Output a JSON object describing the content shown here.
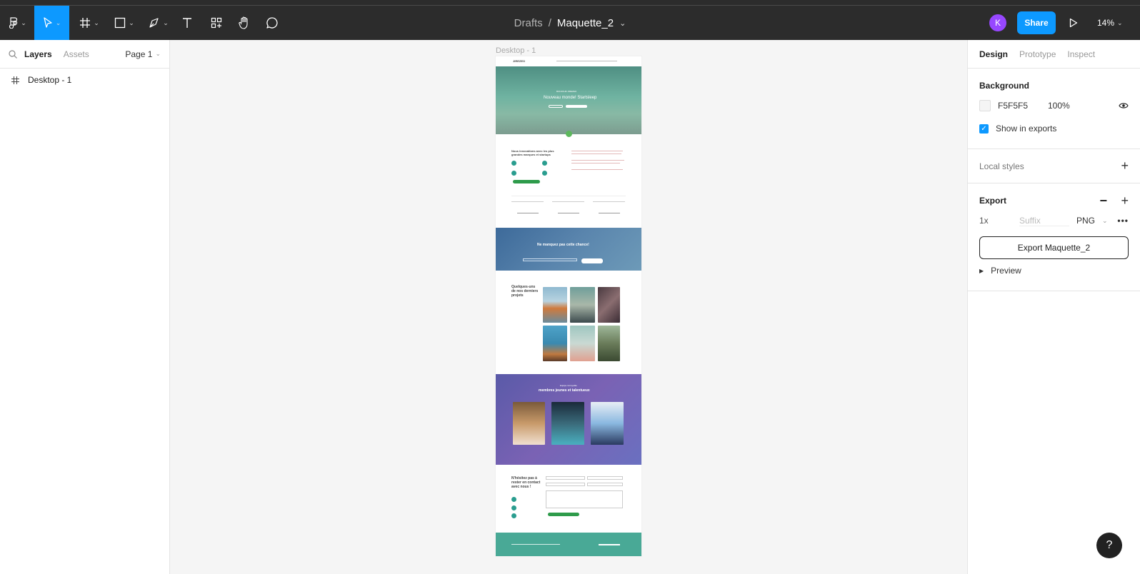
{
  "toolbar": {
    "breadcrumb_parent": "Drafts",
    "breadcrumb_sep": "/",
    "file_name": "Maquette_2",
    "avatar_letter": "K",
    "share_label": "Share",
    "zoom": "14%"
  },
  "left_panel": {
    "tab_layers": "Layers",
    "tab_assets": "Assets",
    "page": "Page 1",
    "layers": [
      {
        "name": "Desktop - 1"
      }
    ]
  },
  "canvas": {
    "frame_label": "Desktop - 1",
    "design": {
      "logo": "JIREZEO",
      "hero_kicker": "BONJOUR JIREZEO",
      "hero_title": "Nouveau monde! Startsleep",
      "newsletter_title": "Ne manquez pas cette chance!",
      "projects_title": "Quelques-uns de nos derniers projets",
      "team_kicker": "Equipe incroyable",
      "team_title": "membres jeunes et talentueux",
      "contact_title": "N'hésitez pas à rester en contact avec nous !",
      "innovations_title": "Nous innovations avec les plus grandes marques et startups"
    }
  },
  "right_panel": {
    "tab_design": "Design",
    "tab_prototype": "Prototype",
    "tab_inspect": "Inspect",
    "background_title": "Background",
    "bg_color": "F5F5F5",
    "bg_opacity": "100%",
    "show_in_exports": "Show in exports",
    "local_styles": "Local styles",
    "export_title": "Export",
    "export_scale": "1x",
    "export_suffix_placeholder": "Suffix",
    "export_format": "PNG",
    "export_button": "Export Maquette_2",
    "preview": "Preview"
  },
  "colors": {
    "accent": "#0d99ff",
    "toolbar_bg": "#2c2c2c",
    "brand_green": "#2a9d8f"
  }
}
